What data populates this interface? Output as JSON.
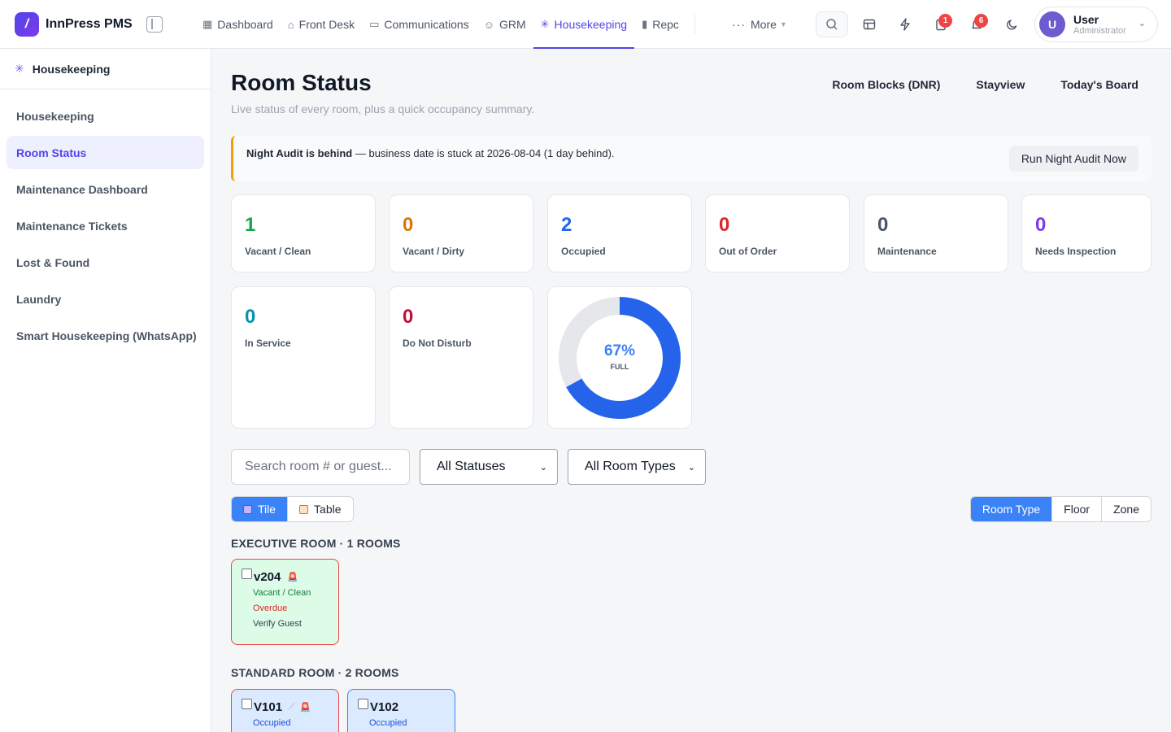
{
  "app": {
    "logo_letter": "/",
    "name": "InnPress PMS"
  },
  "nav": {
    "items": [
      {
        "label": "Dashboard",
        "icon": "grid-icon"
      },
      {
        "label": "Front Desk",
        "icon": "bell-desk-icon"
      },
      {
        "label": "Communications",
        "icon": "chat-icon"
      },
      {
        "label": "GRM",
        "icon": "users-icon"
      },
      {
        "label": "Housekeeping",
        "icon": "sparkle-icon"
      },
      {
        "label": "Repc",
        "icon": "bar-chart-icon"
      }
    ],
    "more_label": "More"
  },
  "toolbar": {
    "tasks_badge": "1",
    "notifications_badge": "6"
  },
  "user": {
    "initial": "U",
    "name": "User",
    "role": "Administrator"
  },
  "sidebar": {
    "title": "Housekeeping",
    "items": [
      "Housekeeping",
      "Room Status",
      "Maintenance Dashboard",
      "Maintenance Tickets",
      "Lost & Found",
      "Laundry",
      "Smart Housekeeping (WhatsApp)"
    ]
  },
  "page": {
    "title": "Room Status",
    "subtitle": "Live status of every room, plus a quick occupancy summary.",
    "links": [
      "Room Blocks (DNR)",
      "Stayview",
      "Today's Board"
    ]
  },
  "alert": {
    "bold": "Night Audit is behind",
    "text": " — business date is stuck at 2026-08-04 (1 day behind).",
    "button": "Run Night Audit Now"
  },
  "stats": [
    {
      "value": "1",
      "label": "Vacant / Clean",
      "color": "#16a34a"
    },
    {
      "value": "0",
      "label": "Vacant / Dirty",
      "color": "#d97706"
    },
    {
      "value": "2",
      "label": "Occupied",
      "color": "#2563eb"
    },
    {
      "value": "0",
      "label": "Out of Order",
      "color": "#dc2626"
    },
    {
      "value": "0",
      "label": "Maintenance",
      "color": "#4b5563"
    },
    {
      "value": "0",
      "label": "Needs Inspection",
      "color": "#7c3aed"
    },
    {
      "value": "0",
      "label": "In Service",
      "color": "#0891b2"
    },
    {
      "value": "0",
      "label": "Do Not Disturb",
      "color": "#be123c"
    }
  ],
  "occupancy": {
    "percent": 67,
    "percent_text": "67%",
    "label": "FULL"
  },
  "filters": {
    "search_placeholder": "Search room # or guest...",
    "status_selected": "All Statuses",
    "type_selected": "All Room Types"
  },
  "view_toggle": [
    "Tile",
    "Table"
  ],
  "group_toggle": [
    "Room Type",
    "Floor",
    "Zone"
  ],
  "groups": [
    {
      "title": "EXECUTIVE ROOM · 1 ROOMS",
      "rooms": [
        {
          "number": "v204",
          "status": "Vacant / Clean",
          "overdue": "Overdue",
          "note": "Verify Guest"
        }
      ]
    },
    {
      "title": "STANDARD ROOM · 2 ROOMS",
      "rooms": [
        {
          "number": "V101",
          "status": "Occupied"
        },
        {
          "number": "V102",
          "status": "Occupied"
        }
      ]
    }
  ]
}
